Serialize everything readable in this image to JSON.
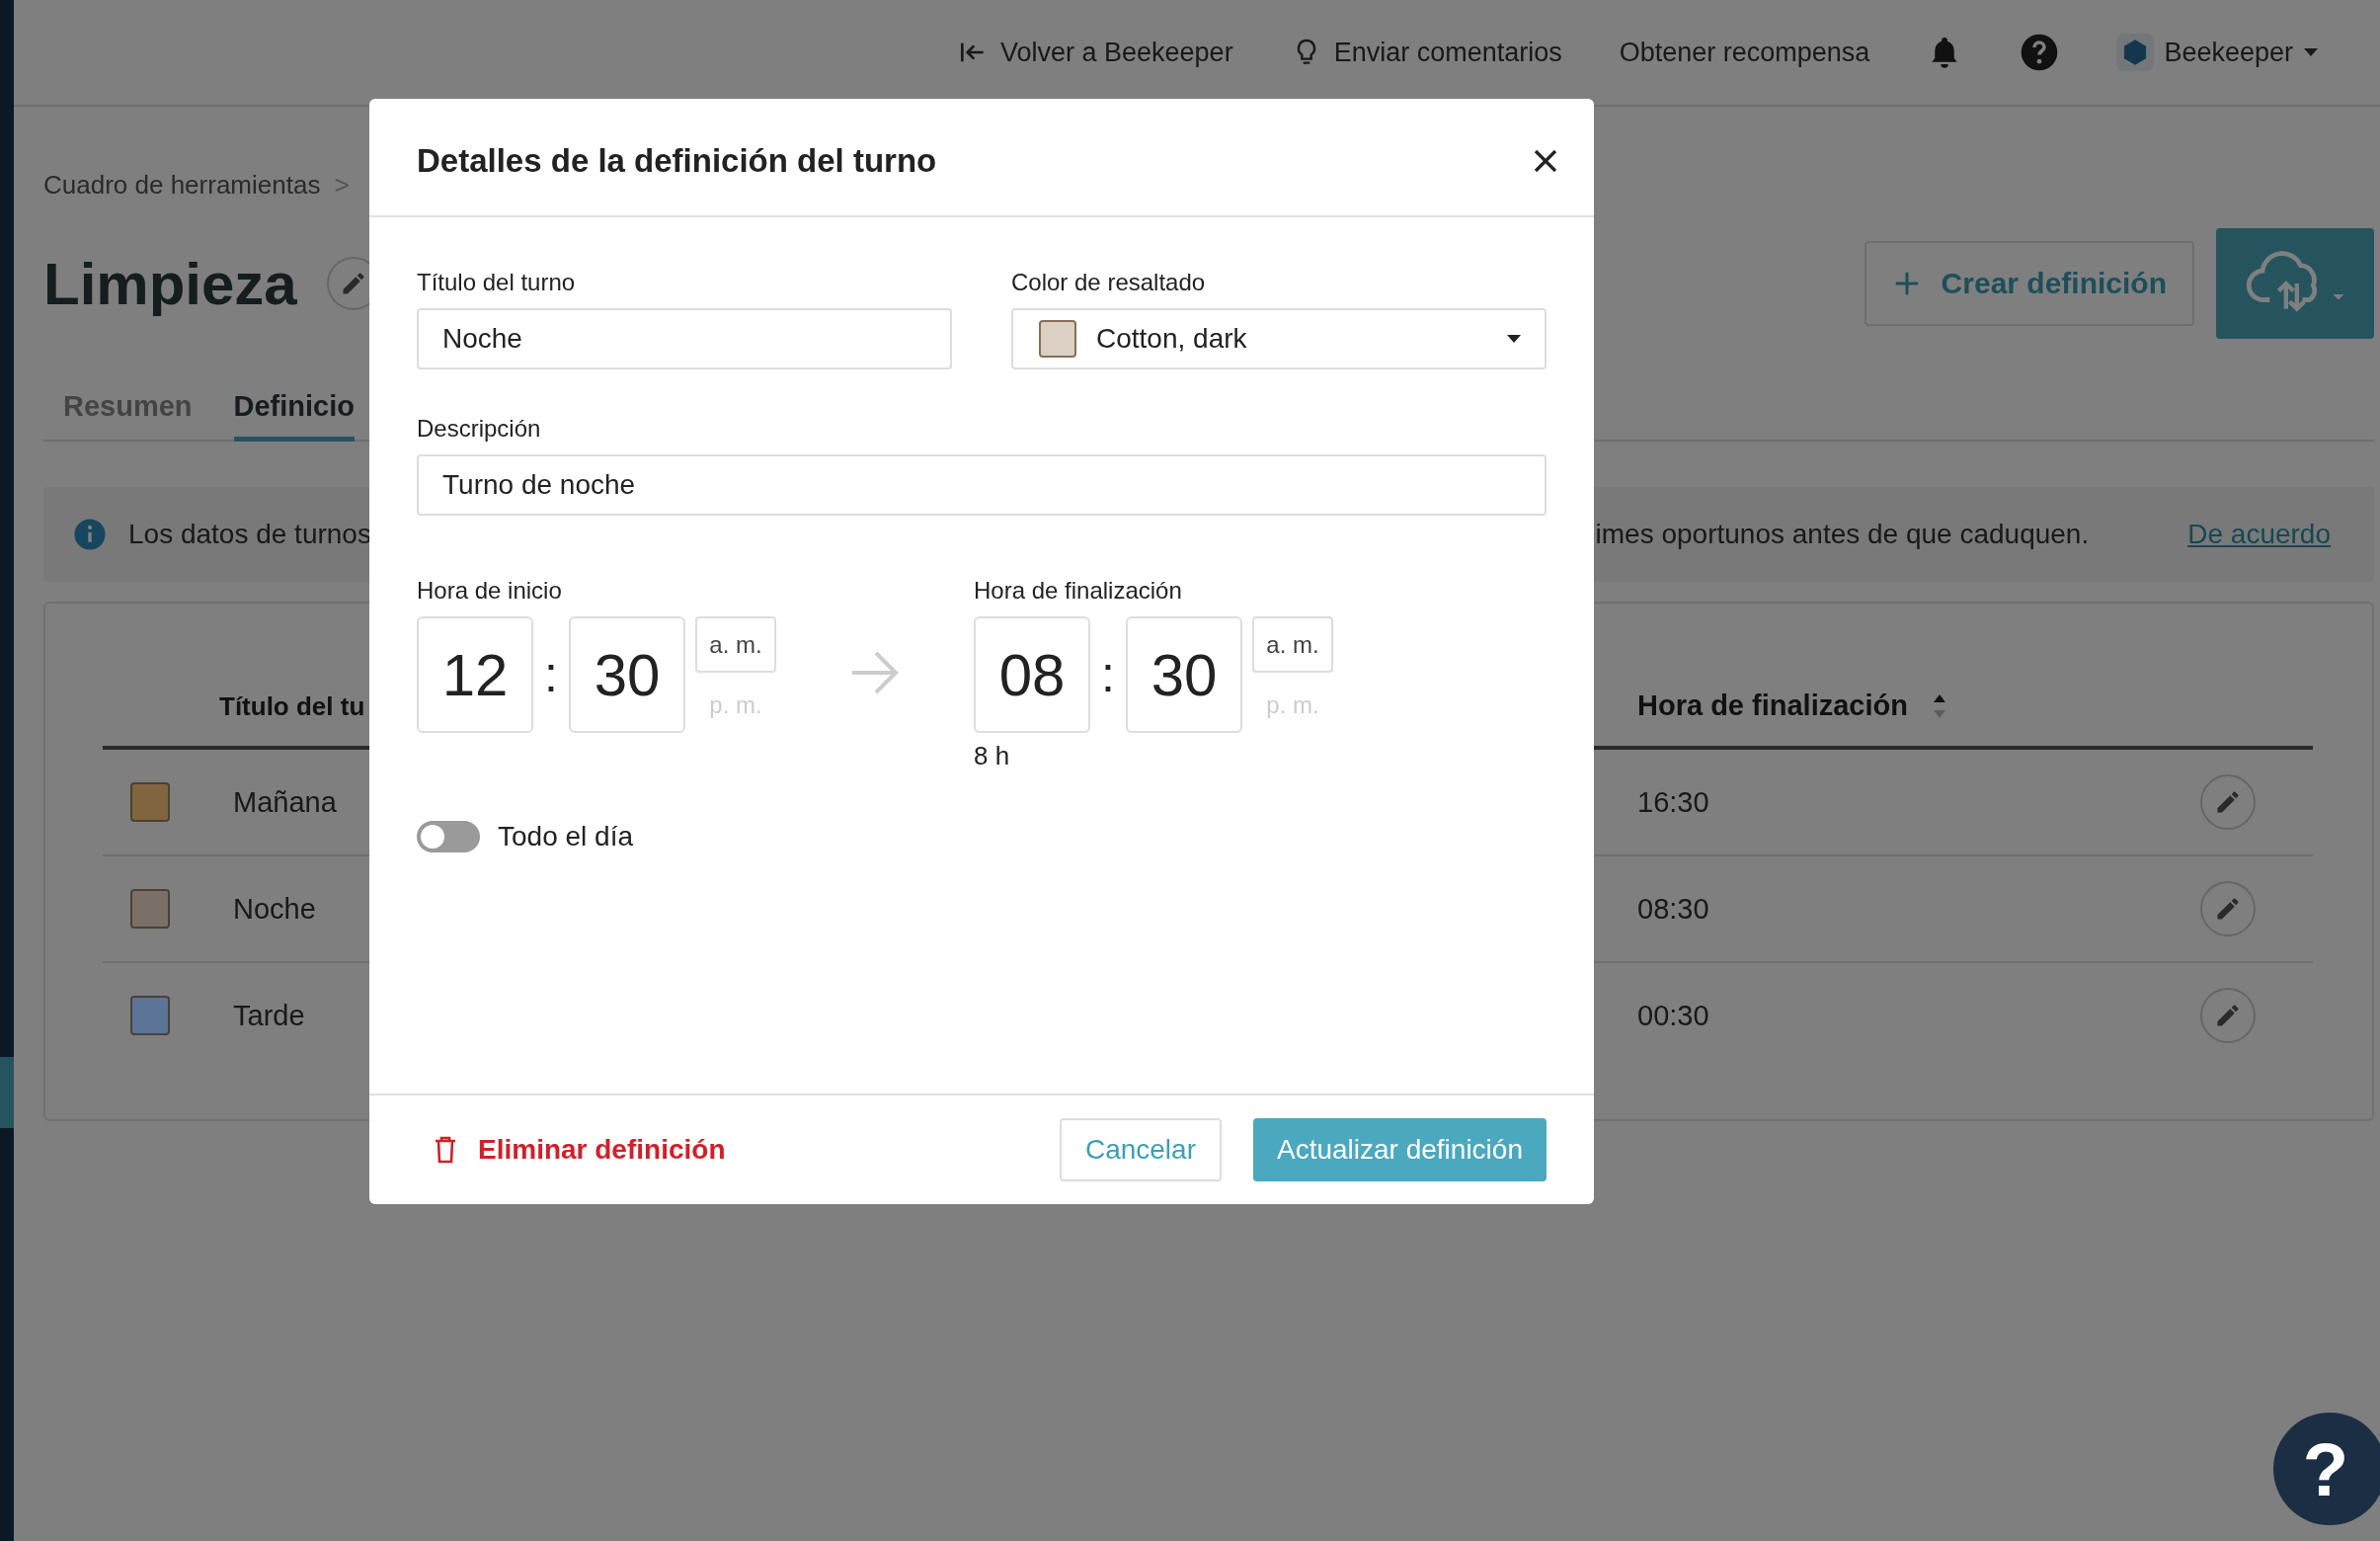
{
  "top_bar": {
    "links": [
      {
        "label": "Volver a Beekeeper",
        "kind": "back"
      },
      {
        "label": "Enviar comentarios",
        "kind": "feedback"
      },
      {
        "label": "Obtener recompensa",
        "kind": "plain"
      }
    ],
    "account": "Beekeeper"
  },
  "breadcrumb": {
    "label": "Cuadro de herramientas",
    "separator": ">"
  },
  "page": {
    "title": "Limpieza",
    "create_button": "Crear definición"
  },
  "tabs": [
    {
      "label": "Resumen",
      "selected": false
    },
    {
      "label": "Definicio",
      "selected": true
    }
  ],
  "banner": {
    "text_start": "Los datos de turnos",
    "text_end": "imes oportunos antes de que caduquen.",
    "link": "De acuerdo"
  },
  "table": {
    "columns": [
      {
        "label": "Título del tu"
      },
      {
        "label": "Hora de finalización",
        "sorted_ascending": true
      }
    ],
    "rows": [
      {
        "color": "#80653f",
        "title": "Mañana",
        "end": "16:30"
      },
      {
        "color": "#7a7068",
        "title": "Noche",
        "end": "08:30"
      },
      {
        "color": "#5d7499",
        "title": "Tarde",
        "end": "00:30"
      }
    ]
  },
  "modal": {
    "title": "Detalles de la definición del turno",
    "shift_title": {
      "label": "Título del turno",
      "value": "Noche"
    },
    "highlight_color": {
      "label": "Color de resaltado",
      "value": "Cotton, dark",
      "color": "#dcd0c4"
    },
    "description": {
      "label": "Descripción",
      "value": "Turno de noche"
    },
    "start": {
      "label": "Hora de inicio",
      "hour": "12",
      "separator": ":",
      "minute": "30",
      "periods": [
        {
          "label": "a. m.",
          "selected": true
        },
        {
          "label": "p. m.",
          "selected": false
        }
      ]
    },
    "end": {
      "label": "Hora de finalización",
      "hour": "08",
      "separator": ":",
      "minute": "30",
      "periods": [
        {
          "label": "a. m.",
          "selected": true
        },
        {
          "label": "p. m.",
          "selected": false
        }
      ],
      "duration": "8 h"
    },
    "all_day": {
      "label": "Todo el día",
      "on": false
    },
    "delete_button": "Eliminar definición",
    "cancel_button": "Cancelar",
    "update_button": "Actualizar definición"
  },
  "help_bubble": "?"
}
